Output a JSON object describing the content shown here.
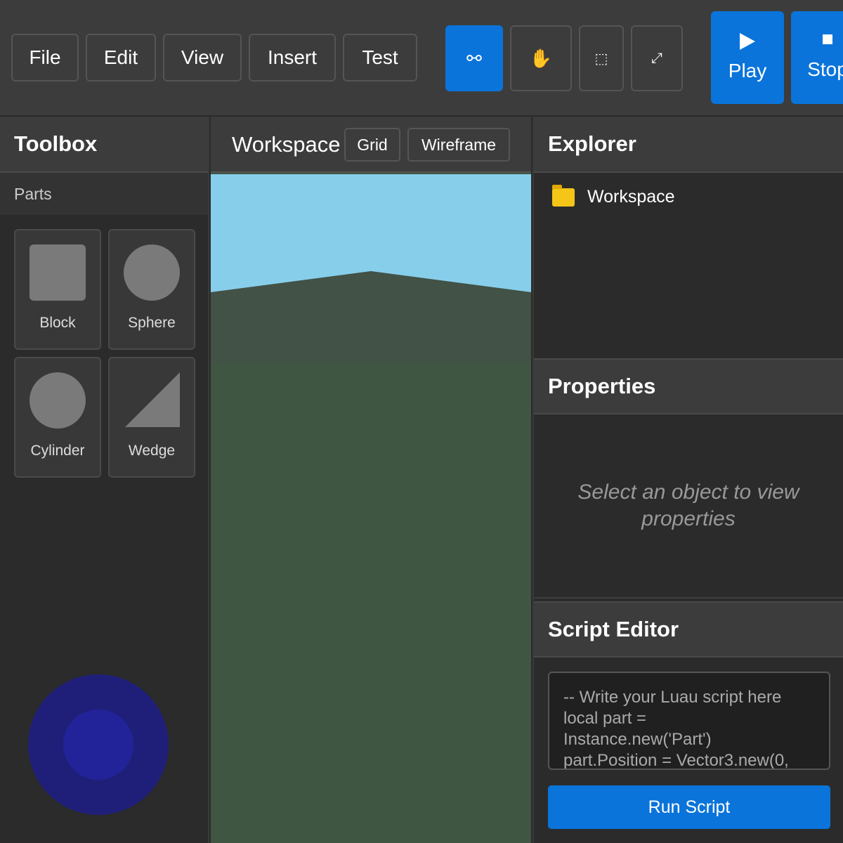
{
  "menu": {
    "file": "File",
    "edit": "Edit",
    "view": "View",
    "insert": "Insert",
    "test": "Test"
  },
  "tools": [
    {
      "glyph": "⚯",
      "icon": "link-icon",
      "active": true
    },
    {
      "glyph": "✋",
      "icon": "hand-icon",
      "active": false
    },
    {
      "glyph": "⬚",
      "icon": "select-box-icon",
      "active": false
    },
    {
      "glyph": "⤢",
      "icon": "scale-arrows-icon",
      "active": false
    }
  ],
  "playback": {
    "play": "Play",
    "stop": "Stop"
  },
  "toolbox": {
    "title": "Toolbox",
    "section": "Parts",
    "parts": [
      "Block",
      "Sphere",
      "Cylinder",
      "Wedge"
    ]
  },
  "workspace": {
    "title": "Workspace",
    "grid": "Grid",
    "wireframe": "Wireframe"
  },
  "explorer": {
    "title": "Explorer",
    "items": [
      "Workspace"
    ]
  },
  "properties": {
    "title": "Properties",
    "empty": "Select an object to view properties"
  },
  "script_editor": {
    "title": "Script Editor",
    "code": "-- Write your Luau script here\nlocal part =\nInstance.new('Part')\npart.Position = Vector3.new(0,",
    "run": "Run Script"
  },
  "colors": {
    "accent": "#0a74da",
    "sky": "#87ceeb",
    "ground": "#3f5642",
    "joystick": "#1f1f7a"
  }
}
